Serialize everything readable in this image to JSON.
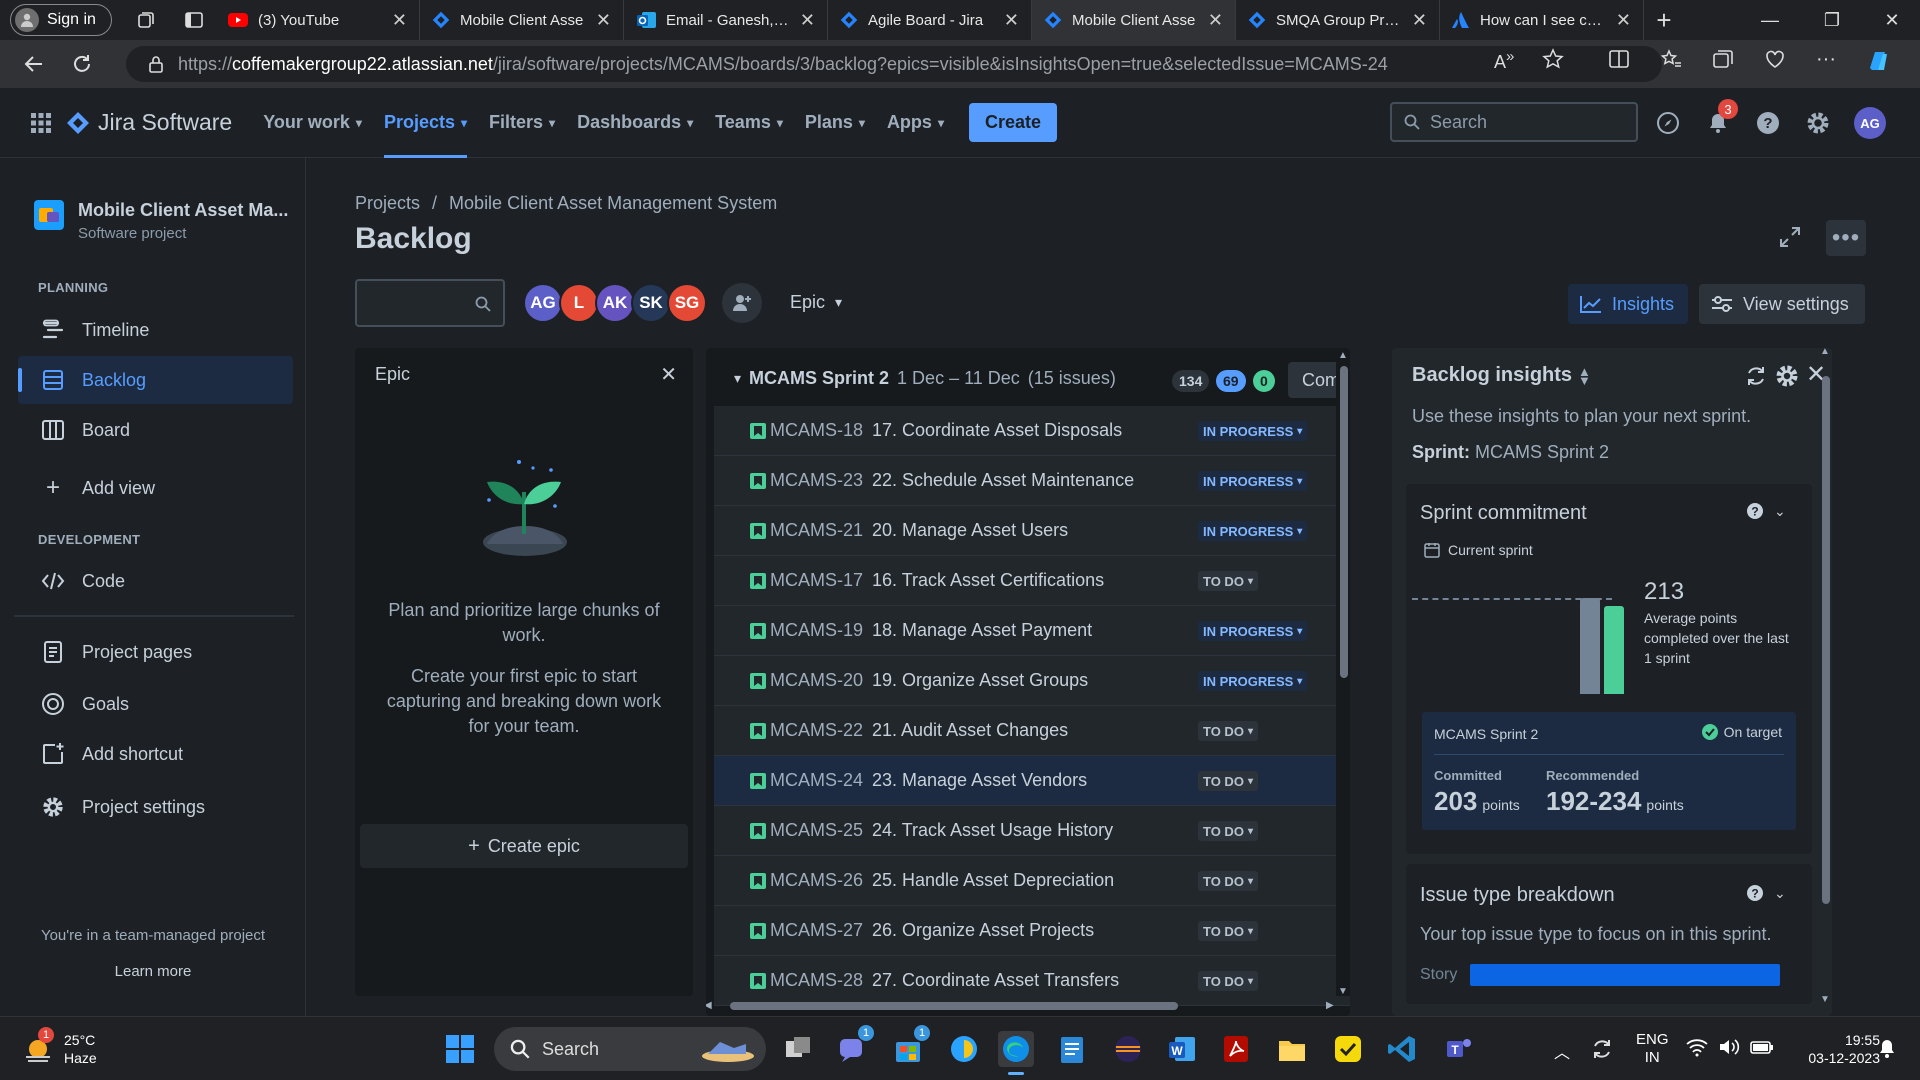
{
  "browser": {
    "signin": "Sign in",
    "tabs": [
      {
        "title": "(3) YouTube",
        "icon": "youtube-icon"
      },
      {
        "title": "Mobile Client Asse",
        "icon": "jira-icon"
      },
      {
        "title": "Email - Ganesh, Ar",
        "icon": "outlook-icon"
      },
      {
        "title": "Agile Board - Jira",
        "icon": "jira-icon"
      },
      {
        "title": "Mobile Client Asse",
        "icon": "jira-icon",
        "active": true
      },
      {
        "title": "SMQA Group Proje",
        "icon": "jira-icon"
      },
      {
        "title": "How can I see com",
        "icon": "atlassian-icon"
      }
    ],
    "url_prefix": "https://",
    "url_host": "coffemakergroup22.atlassian.net",
    "url_path": "/jira/software/projects/MCAMS/boards/3/backlog?epics=visible&isInsightsOpen=true&selectedIssue=MCAMS-24"
  },
  "header": {
    "product": "Jira Software",
    "nav": [
      "Your work",
      "Projects",
      "Filters",
      "Dashboards",
      "Teams",
      "Plans",
      "Apps"
    ],
    "create": "Create",
    "search_placeholder": "Search",
    "notif_count": "3",
    "user_initials": "AG"
  },
  "sidebar": {
    "project_name": "Mobile Client Asset Ma...",
    "project_type": "Software project",
    "planning": "PLANNING",
    "development": "DEVELOPMENT",
    "items": {
      "timeline": "Timeline",
      "backlog": "Backlog",
      "board": "Board",
      "add_view": "Add view",
      "code": "Code",
      "project_pages": "Project pages",
      "goals": "Goals",
      "add_shortcut": "Add shortcut",
      "project_settings": "Project settings"
    },
    "footer_text": "You're in a team-managed project",
    "learn_more": "Learn more"
  },
  "main": {
    "breadcrumb": [
      "Projects",
      "/",
      "Mobile Client Asset Management System"
    ],
    "title": "Backlog",
    "avatars": [
      {
        "initials": "AG",
        "color": "#5b5fc7"
      },
      {
        "initials": "L",
        "color": "#e34935"
      },
      {
        "initials": "AK",
        "color": "#6554c0"
      },
      {
        "initials": "SK",
        "color": "#253858"
      },
      {
        "initials": "SG",
        "color": "#e34935"
      }
    ],
    "epic_filter": "Epic",
    "insights_btn": "Insights",
    "view_settings_btn": "View settings"
  },
  "epic_panel": {
    "title": "Epic",
    "text1": "Plan and prioritize large chunks of work.",
    "text2": "Create your first epic to start capturing and breaking down work for your team.",
    "create": "Create epic"
  },
  "sprint": {
    "name": "MCAMS Sprint 2",
    "dates": "1 Dec – 11 Dec",
    "count": "(15 issues)",
    "points_todo": "134",
    "points_ip": "69",
    "points_done": "0",
    "complete_btn": "Comp",
    "issues": [
      {
        "key": "MCAMS-18",
        "summary": "17. Coordinate Asset Disposals",
        "status": "IN PROGRESS"
      },
      {
        "key": "MCAMS-23",
        "summary": "22. Schedule Asset Maintenance",
        "status": "IN PROGRESS"
      },
      {
        "key": "MCAMS-21",
        "summary": "20. Manage Asset Users",
        "status": "IN PROGRESS"
      },
      {
        "key": "MCAMS-17",
        "summary": "16. Track Asset Certifications",
        "status": "TO DO"
      },
      {
        "key": "MCAMS-19",
        "summary": "18. Manage Asset Payment",
        "status": "IN PROGRESS"
      },
      {
        "key": "MCAMS-20",
        "summary": "19. Organize Asset Groups",
        "status": "IN PROGRESS"
      },
      {
        "key": "MCAMS-22",
        "summary": "21. Audit Asset Changes",
        "status": "TO DO"
      },
      {
        "key": "MCAMS-24",
        "summary": "23. Manage Asset Vendors",
        "status": "TO DO",
        "selected": true
      },
      {
        "key": "MCAMS-25",
        "summary": "24. Track Asset Usage History",
        "status": "TO DO"
      },
      {
        "key": "MCAMS-26",
        "summary": "25. Handle Asset Depreciation",
        "status": "TO DO"
      },
      {
        "key": "MCAMS-27",
        "summary": "26. Organize Asset Projects",
        "status": "TO DO"
      },
      {
        "key": "MCAMS-28",
        "summary": "27. Coordinate Asset Transfers",
        "status": "TO DO"
      }
    ]
  },
  "insights": {
    "title": "Backlog insights",
    "desc": "Use these insights to plan your next sprint.",
    "sprint_label": "Sprint:",
    "sprint_value": "MCAMS Sprint 2",
    "commitment": {
      "title": "Sprint commitment",
      "current": "Current sprint",
      "avg_value": "213",
      "avg_text": "Average points completed over the last 1 sprint",
      "sprint_name": "MCAMS Sprint 2",
      "on_target": "On target",
      "committed_label": "Committed",
      "committed_value": "203",
      "recommended_label": "Recommended",
      "recommended_value": "192-234",
      "points": "points"
    },
    "breakdown": {
      "title": "Issue type breakdown",
      "desc": "Your top issue type to focus on in this sprint.",
      "type": "Story"
    }
  },
  "taskbar": {
    "temp": "25°C",
    "weather": "Haze",
    "weather_badge": "1",
    "search": "Search",
    "lang1": "ENG",
    "lang2": "IN",
    "time": "19:55",
    "date": "03-12-2023",
    "teams_badge": "1",
    "store_badge": "1"
  }
}
